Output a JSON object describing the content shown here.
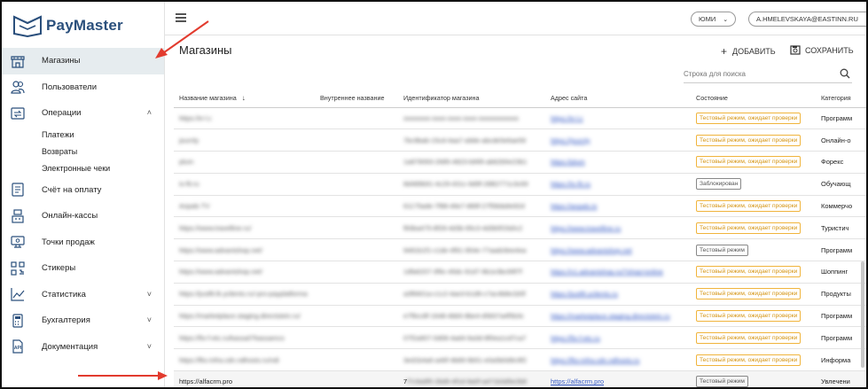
{
  "brand": {
    "name": "PayMaster"
  },
  "sidebar": {
    "items": [
      {
        "label": "Магазины",
        "icon": "store-icon",
        "active": true
      },
      {
        "label": "Пользователи",
        "icon": "users-icon"
      },
      {
        "label": "Операции",
        "icon": "operations-icon",
        "expanded": true,
        "children": [
          "Платежи",
          "Возвраты",
          "Электронные чеки"
        ]
      },
      {
        "label": "Счёт на оплату",
        "icon": "invoice-icon"
      },
      {
        "label": "Онлайн-кассы",
        "icon": "cash-register-icon"
      },
      {
        "label": "Точки продаж",
        "icon": "pos-icon"
      },
      {
        "label": "Стикеры",
        "icon": "qr-sticker-icon"
      },
      {
        "label": "Статистика",
        "icon": "chart-icon",
        "expandable": true
      },
      {
        "label": "Бухгалтерия",
        "icon": "calculator-icon",
        "expandable": true
      },
      {
        "label": "Документация",
        "icon": "api-icon",
        "expandable": true
      }
    ]
  },
  "topbar": {
    "org": "ЮМИ",
    "user": "A.HMELEVSKAYA@EASTINN.RU"
  },
  "page": {
    "title": "Магазины",
    "add_label": "ДОБАВИТЬ",
    "save_label": "СОХРАНИТЬ",
    "search_placeholder": "Строка для поиска"
  },
  "table": {
    "columns": [
      "Название магазина",
      "Внутреннее название",
      "Идентификатор магазина",
      "Адрес сайта",
      "Состояние",
      "Категория"
    ],
    "rows": [
      {
        "name": "https://e-l.c",
        "id": "xxxxxxxx-xxxx-xxxx-xxxx-xxxxxxxxxxxx",
        "site": "https://e-l.c",
        "status": "Тестовый режим, ожидает проверки",
        "status_kind": "warn",
        "category": "Программ",
        "blurred": true
      },
      {
        "name": "journly",
        "id": "7bc9bab-15cd-4aa7-a9de-abcde5e6ae59",
        "site": "https://journly",
        "status": "Тестовый режим, ожидает проверки",
        "status_kind": "warn",
        "category": "Онлайн-о",
        "blurred": true
      },
      {
        "name": "plum",
        "id": "1a879093-2685-4823-b995-ab62b5e23b1",
        "site": "https://plum",
        "status": "Тестовый режим, ожидает проверки",
        "status_kind": "warn",
        "category": "Форекс",
        "blurred": true
      },
      {
        "name": "is-fit.ru",
        "id": "8d489b91-4c29-431c-9d9f-28B2771c3c69",
        "site": "https://is-fit.ru",
        "status": "Заблокирован",
        "status_kind": "grey",
        "category": "Обучающ",
        "blurred": true
      },
      {
        "name": "Anpals TV",
        "id": "61175ade-7f88-46e7-889f-27f58da9e92d",
        "site": "https://anpals.tv",
        "status": "Тестовый режим, ожидает проверки",
        "status_kind": "warn",
        "category": "Коммерчо",
        "blurred": true
      },
      {
        "name": "https://www.travelline.ru/",
        "id": "f83ba475-8f28-4d3b-95c3-4d3b5f1fa5c2",
        "site": "https://www.travelline.ru",
        "status": "Тестовый режим, ожидает проверки",
        "status_kind": "warn",
        "category": "Туристич",
        "blurred": true
      },
      {
        "name": "https://www.advantshop.net/",
        "id": "9481b1f1-c1de-4f91-954e-77aadc8ee4ea",
        "site": "https://www.advantshop.net",
        "status": "Тестовый режим",
        "status_kind": "grey",
        "category": "Программ",
        "blurred": true
      },
      {
        "name": "https://www.advantshop.net/",
        "id": "1dfa6207-3f9c-45dc-91d7-9b1e3bc99f7f",
        "site": "https://v1.advantshop.ru/?shop=online",
        "status": "Тестовый режим, ожидает проверки",
        "status_kind": "warn",
        "category": "Шоппинг",
        "blurred": true
      },
      {
        "name": "https://justfit.lk.yclients.ru/-pro-payplatforma",
        "id": "a3f6601a-c1c2-4ae3-b1d6-c7ac4b8e1b5f",
        "site": "https://justfit.yclients.ru",
        "status": "Тестовый режим, ожидает проверки",
        "status_kind": "warn",
        "category": "Продукты",
        "blurred": true
      },
      {
        "name": "https://marketplace.staging.directstein.ru/",
        "id": "e7f9cc8f-1648-4bb5-8be4-d5837a4f5b3c",
        "site": "https://marketplace.staging.directstein.ru",
        "status": "Тестовый режим, ожидает проверки",
        "status_kind": "warn",
        "category": "Программ",
        "blurred": true
      },
      {
        "name": "https://fix-f-etc.ru/kassa/i?kassamcs",
        "id": "07f2a907-0d08-4ad4-9a3d-8f0ea1cd7ca7",
        "site": "https://fix-f-etc.ru",
        "status": "Тестовый режим, ожидает проверки",
        "status_kind": "warn",
        "category": "Программ",
        "blurred": true
      },
      {
        "name": "https://fks-infra.cdn.ndhosts.ru/ndi",
        "id": "3ed1b4a6-a46f-4b89-9b51-e0a5b0d9c9f2",
        "site": "https://fks-infra.cdn.ndhosts.ru",
        "status": "Тестовый режим, ожидает проверки",
        "status_kind": "warn",
        "category": "Информа",
        "blurred": true
      },
      {
        "name": "https://alfacrm.pro",
        "id": "7",
        "id_tail": "f7c9a9f0-2bd6-4f1d-9a0f-a471b3d5e2b8",
        "site": "https://alfacrm.pro",
        "status": "Тестовый режим",
        "status_kind": "grey",
        "category": "Увлечени",
        "blurred": false
      }
    ]
  }
}
